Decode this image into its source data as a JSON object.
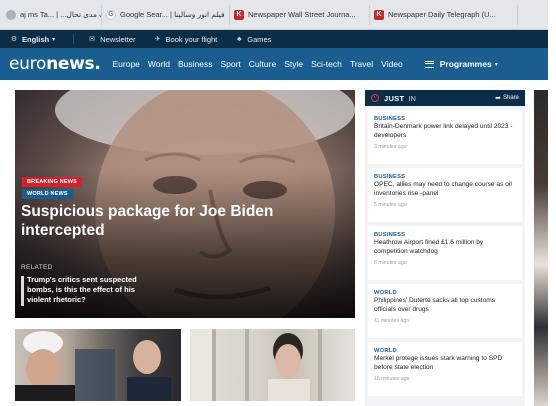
{
  "browser": {
    "bookmarks": [
      {
        "label": "aj ms Ta... | ...قيس لكتاب مدى تحال",
        "icon": "globe-icon"
      },
      {
        "label": "Google Sear... | فيلم انور وسالينا",
        "icon": "google-icon"
      },
      {
        "label": "Newspaper Wall Street Journa...",
        "icon": "bookmark-icon"
      },
      {
        "label": "Newspaper Daily Telegraph (U...",
        "icon": "bookmark-icon"
      }
    ]
  },
  "topbar": {
    "language": "English",
    "newsletter": "Newsletter",
    "book_flight": "Book your flight",
    "games": "Games"
  },
  "nav": {
    "logo_a": "euro",
    "logo_b": "news.",
    "items": [
      "Europe",
      "World",
      "Business",
      "Sport",
      "Culture",
      "Style",
      "Sci-tech",
      "Travel",
      "Video"
    ],
    "programmes": "Programmes"
  },
  "hero": {
    "badge_breaking": "BREAKING NEWS",
    "badge_world": "WORLD NEWS",
    "title": "Suspicious package for Joe Biden intercepted",
    "related_label": "RELATED",
    "related_text": "Trump's critics sent suspected bombs, is this the effect of his violent rhetoric?"
  },
  "sidebar": {
    "just": "JUST",
    "in": "IN",
    "share": "Share",
    "items": [
      {
        "category": "BUSINESS",
        "title": "Britain-Denmark power link delayed until 2023 - developers",
        "time": "3 minutes ago"
      },
      {
        "category": "BUSINESS",
        "title": "OPEC, allies may need to change course as oil inventories rise -panel",
        "time": "5 minutes ago"
      },
      {
        "category": "BUSINESS",
        "title": "Heathrow Airport fined £1.6 million by competition watchdog",
        "time": "8 minutes ago"
      },
      {
        "category": "WORLD",
        "title": "Philippines' Duterte sacks all top customs officials over drugs",
        "time": "11 minutes ago"
      },
      {
        "category": "WORLD",
        "title": "Merkel protege issues stark warning to SPD before state election",
        "time": "15 minutes ago"
      }
    ]
  },
  "colors": {
    "topbar": "#0c2d48",
    "nav": "#1a5e8f",
    "breaking": "#d6202b",
    "category": "#1a5e8f"
  }
}
